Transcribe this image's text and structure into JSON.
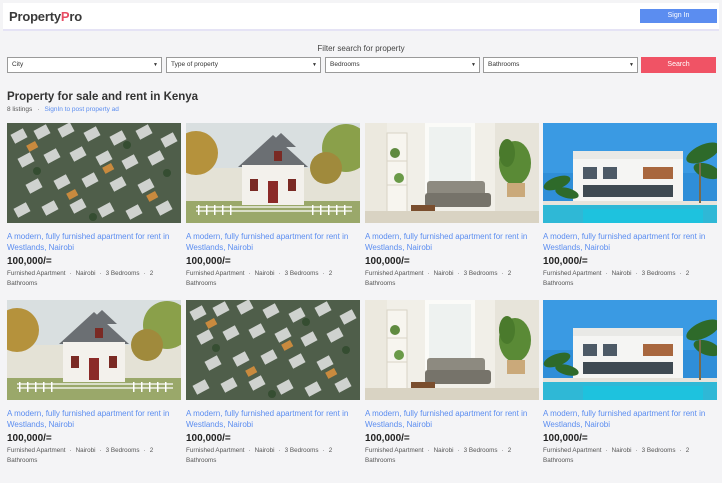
{
  "header": {
    "logo_part1": "Property",
    "logo_accent": "P",
    "logo_part2": "ro",
    "signin_label": "Sign In"
  },
  "filters": {
    "title": "Filter search for property",
    "city": "City",
    "type": "Type of property",
    "bedrooms": "Bedrooms",
    "bathrooms": "Bathrooms",
    "search_label": "Search"
  },
  "listings_header": {
    "title": "Property for sale and rent in Kenya",
    "count": "8 listings",
    "post_link": "SignIn to post property ad"
  },
  "cards": [
    {
      "image": "aerial-houses-image",
      "title": "A modern, fully furnished apartment for rent in Westlands, Nairobi",
      "price": "100,000/=",
      "kind": "Furnished Apartment",
      "city": "Nairobi",
      "bedrooms": "3 Bedrooms",
      "bathrooms": "2 Bathrooms"
    },
    {
      "image": "white-cottage-image",
      "title": "A modern, fully furnished apartment for rent in Westlands, Nairobi",
      "price": "100,000/=",
      "kind": "Furnished Apartment",
      "city": "Nairobi",
      "bedrooms": "3 Bedrooms",
      "bathrooms": "2 Bathrooms"
    },
    {
      "image": "living-room-image",
      "title": "A modern, fully furnished apartment for rent in Westlands, Nairobi",
      "price": "100,000/=",
      "kind": "Furnished Apartment",
      "city": "Nairobi",
      "bedrooms": "3 Bedrooms",
      "bathrooms": "2 Bathrooms"
    },
    {
      "image": "pool-villa-image",
      "title": "A modern, fully furnished apartment for rent in Westlands, Nairobi",
      "price": "100,000/=",
      "kind": "Furnished Apartment",
      "city": "Nairobi",
      "bedrooms": "3 Bedrooms",
      "bathrooms": "2 Bathrooms"
    },
    {
      "image": "white-cottage-image",
      "title": "A modern, fully furnished apartment for rent in Westlands, Nairobi",
      "price": "100,000/=",
      "kind": "Furnished Apartment",
      "city": "Nairobi",
      "bedrooms": "3 Bedrooms",
      "bathrooms": "2 Bathrooms"
    },
    {
      "image": "aerial-houses-image",
      "title": "A modern, fully furnished apartment for rent in Westlands, Nairobi",
      "price": "100,000/=",
      "kind": "Furnished Apartment",
      "city": "Nairobi",
      "bedrooms": "3 Bedrooms",
      "bathrooms": "2 Bathrooms"
    },
    {
      "image": "living-room-image",
      "title": "A modern, fully furnished apartment for rent in Westlands, Nairobi",
      "price": "100,000/=",
      "kind": "Furnished Apartment",
      "city": "Nairobi",
      "bedrooms": "3 Bedrooms",
      "bathrooms": "2 Bathrooms"
    },
    {
      "image": "pool-villa-image",
      "title": "A modern, fully furnished apartment for rent in Westlands, Nairobi",
      "price": "100,000/=",
      "kind": "Furnished Apartment",
      "city": "Nairobi",
      "bedrooms": "3 Bedrooms",
      "bathrooms": "2 Bathrooms"
    }
  ],
  "colors": {
    "accent_blue": "#5b8df0",
    "accent_red": "#f05365",
    "logo_accent": "#e84c63"
  }
}
